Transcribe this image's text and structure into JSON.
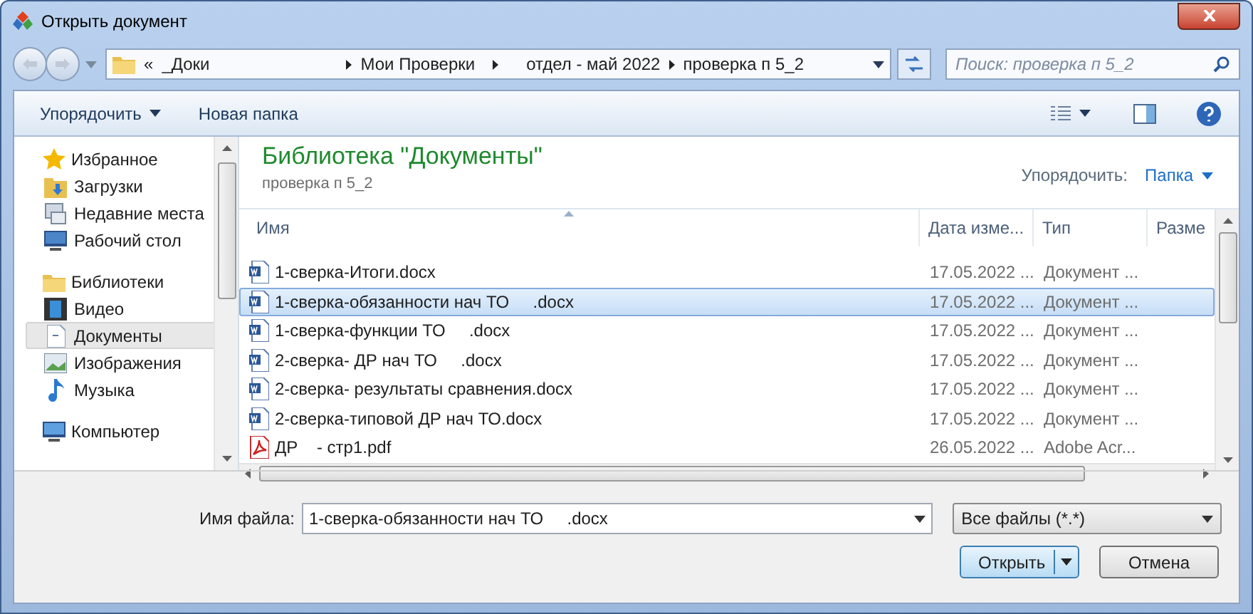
{
  "window": {
    "title": "Открыть документ"
  },
  "address": {
    "crumbs": [
      "«",
      "_Доки",
      "Мои Проверки",
      "отдел - май 2022",
      "проверка п 5_2"
    ]
  },
  "search": {
    "placeholder": "Поиск: проверка п 5_2"
  },
  "toolbar": {
    "organize": "Упорядочить",
    "new_folder": "Новая папка"
  },
  "sidebar": {
    "groups": [
      {
        "label": "Избранное",
        "children": [
          {
            "label": "Загрузки",
            "selected": false
          },
          {
            "label": "Недавние места",
            "selected": false
          },
          {
            "label": "Рабочий стол",
            "selected": false
          }
        ]
      },
      {
        "label": "Библиотеки",
        "children": [
          {
            "label": "Видео",
            "selected": false
          },
          {
            "label": "Документы",
            "selected": true
          },
          {
            "label": "Изображения",
            "selected": false
          },
          {
            "label": "Музыка",
            "selected": false
          }
        ]
      },
      {
        "label": "Компьютер"
      }
    ]
  },
  "library": {
    "title": "Библиотека \"Документы\"",
    "subtitle": "проверка п 5_2",
    "arrange_label": "Упорядочить:",
    "arrange_value": "Папка"
  },
  "table": {
    "columns": [
      "Имя",
      "Дата изме...",
      "Тип",
      "Разме"
    ],
    "rows": [
      {
        "name": "1-сверка-Итоги.docx",
        "date": "17.05.2022 ...",
        "type": "Документ ...",
        "kind": "word",
        "selected": false
      },
      {
        "name": "1-сверка-обязанности нач ТО     .docx",
        "date": "17.05.2022 ...",
        "type": "Документ ...",
        "kind": "word",
        "selected": true
      },
      {
        "name": "1-сверка-функции ТО     .docx",
        "date": "17.05.2022 ...",
        "type": "Документ ...",
        "kind": "word",
        "selected": false
      },
      {
        "name": "2-сверка- ДР нач ТО     .docx",
        "date": "17.05.2022 ...",
        "type": "Документ ...",
        "kind": "word",
        "selected": false
      },
      {
        "name": "2-сверка- результаты сравнения.docx",
        "date": "17.05.2022 ...",
        "type": "Документ ...",
        "kind": "word",
        "selected": false
      },
      {
        "name": "2-сверка-типовой ДР нач ТО.docx",
        "date": "17.05.2022 ...",
        "type": "Документ ...",
        "kind": "word",
        "selected": false
      },
      {
        "name": "ДР    - стр1.pdf",
        "date": "26.05.2022 ...",
        "type": "Adobe Acr...",
        "kind": "pdf",
        "selected": false
      }
    ]
  },
  "filename": {
    "label": "Имя файла:",
    "value": "1-сверка-обязанности нач ТО     .docx"
  },
  "filter": {
    "value": "Все файлы (*.*)"
  },
  "buttons": {
    "open": "Открыть",
    "cancel": "Отмена"
  }
}
